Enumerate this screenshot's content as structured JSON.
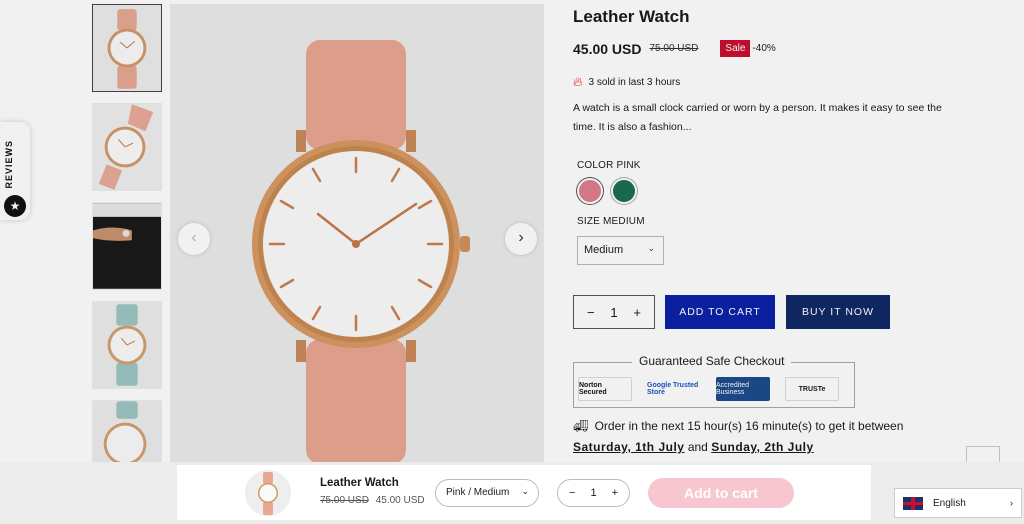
{
  "reviews_tab": {
    "label": "REVIEWS",
    "icon": "star-icon"
  },
  "gallery": {
    "prev_icon": "chevron-left-icon",
    "next_icon": "chevron-right-icon",
    "thumbnail_count": 5
  },
  "product": {
    "title": "Leather Watch",
    "price": "45.00 USD",
    "compare_price": "75.00 USD",
    "sale_badge": "Sale",
    "discount": "-40%",
    "sold_text": "3 sold in last 3 hours",
    "description": "A watch is a small clock carried or worn by a person. It makes it easy to see the time. It is also a fashion...",
    "color_label": "COLOR PINK",
    "colors": [
      "#e07e8f",
      "#1a6d53"
    ],
    "size_label": "SIZE MEDIUM",
    "size_value": "Medium",
    "quantity": "1",
    "add_to_cart": "ADD TO CART",
    "buy_now": "BUY IT NOW",
    "checkout_title": "Guaranteed Safe Checkout",
    "trust_badges": [
      "Norton Secured",
      "Google Trusted Store",
      "Accredited Business",
      "TRUSTe"
    ],
    "delivery_prefix": "Order in the next 15 hour(s) 16 minute(s) to get it between",
    "delivery_start": "Saturday, 1th July",
    "delivery_and": "and",
    "delivery_end": "Sunday, 2th July"
  },
  "sticky_bar": {
    "title": "Leather Watch",
    "old_price": "75.00 USD",
    "new_price": "45.00 USD",
    "variant": "Pink / Medium",
    "quantity": "1",
    "add_to_cart": "Add to cart"
  },
  "language": {
    "label": "English"
  },
  "colors": {
    "accent_blue": "#0b22a8",
    "buy_now": "#102a66",
    "sale_red": "#c8102e",
    "sticky_add": "#f7c6cf"
  }
}
